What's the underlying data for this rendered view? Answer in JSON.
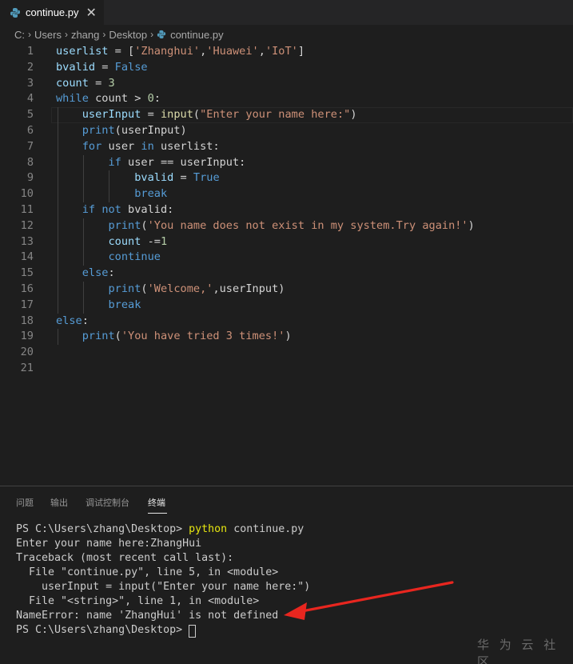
{
  "tab": {
    "label": "continue.py",
    "close_glyph": "✕"
  },
  "breadcrumb": {
    "drive": "C:",
    "items": [
      "Users",
      "zhang",
      "Desktop"
    ],
    "file": "continue.py"
  },
  "editor": {
    "line_numbers": [
      "1",
      "2",
      "3",
      "4",
      "5",
      "6",
      "7",
      "8",
      "9",
      "10",
      "11",
      "12",
      "13",
      "14",
      "15",
      "16",
      "17",
      "18",
      "19",
      "20",
      "21"
    ],
    "lines": [
      [
        [
          "userlist",
          "var"
        ],
        [
          " = [",
          "op"
        ],
        [
          "'Zhanghui'",
          "str"
        ],
        [
          ",",
          "op"
        ],
        [
          "'Huawei'",
          "str"
        ],
        [
          ",",
          "op"
        ],
        [
          "'IoT'",
          "str"
        ],
        [
          "]",
          "op"
        ]
      ],
      [
        [
          "bvalid",
          "var"
        ],
        [
          " = ",
          "op"
        ],
        [
          "False",
          "kw"
        ]
      ],
      [
        [
          "count",
          "var"
        ],
        [
          " = ",
          "op"
        ],
        [
          "3",
          "num"
        ]
      ],
      [
        [
          "while",
          "kw"
        ],
        [
          " count > ",
          "op"
        ],
        [
          "0",
          "num"
        ],
        [
          ":",
          "op"
        ]
      ],
      [
        [
          "    ",
          "op"
        ],
        [
          "userInput",
          "var"
        ],
        [
          " = ",
          "op"
        ],
        [
          "input",
          "fn"
        ],
        [
          "(",
          "op"
        ],
        [
          "\"Enter your name here:\"",
          "str"
        ],
        [
          ")",
          "op"
        ]
      ],
      [
        [
          "    ",
          "op"
        ],
        [
          "print",
          "kw"
        ],
        [
          "(userInput)",
          "op"
        ]
      ],
      [
        [
          "    ",
          "op"
        ],
        [
          "for",
          "kw"
        ],
        [
          " user ",
          "op"
        ],
        [
          "in",
          "kw"
        ],
        [
          " userlist:",
          "op"
        ]
      ],
      [
        [
          "        ",
          "op"
        ],
        [
          "if",
          "kw"
        ],
        [
          " user == userInput:",
          "op"
        ]
      ],
      [
        [
          "            ",
          "op"
        ],
        [
          "bvalid",
          "var"
        ],
        [
          " = ",
          "op"
        ],
        [
          "True",
          "kw"
        ]
      ],
      [
        [
          "            ",
          "op"
        ],
        [
          "break",
          "kw"
        ]
      ],
      [
        [
          "    ",
          "op"
        ],
        [
          "if",
          "kw"
        ],
        [
          " ",
          "op"
        ],
        [
          "not",
          "kw"
        ],
        [
          " bvalid:",
          "op"
        ]
      ],
      [
        [
          "        ",
          "op"
        ],
        [
          "print",
          "kw"
        ],
        [
          "(",
          "op"
        ],
        [
          "'You name does not exist in my system.Try again!'",
          "str"
        ],
        [
          ")",
          "op"
        ]
      ],
      [
        [
          "        ",
          "op"
        ],
        [
          "count",
          "var"
        ],
        [
          " -=",
          "op"
        ],
        [
          "1",
          "num"
        ]
      ],
      [
        [
          "        ",
          "op"
        ],
        [
          "continue",
          "kw"
        ]
      ],
      [
        [
          "    ",
          "op"
        ],
        [
          "else",
          "kw"
        ],
        [
          ":",
          "op"
        ]
      ],
      [
        [
          "        ",
          "op"
        ],
        [
          "print",
          "kw"
        ],
        [
          "(",
          "op"
        ],
        [
          "'Welcome,'",
          "str"
        ],
        [
          ",userInput)",
          "op"
        ]
      ],
      [
        [
          "        ",
          "op"
        ],
        [
          "break",
          "kw"
        ]
      ],
      [
        [
          "else",
          "kw"
        ],
        [
          ":",
          "op"
        ]
      ],
      [
        [
          "    ",
          "op"
        ],
        [
          "print",
          "kw"
        ],
        [
          "(",
          "op"
        ],
        [
          "'You have tried 3 times!'",
          "str"
        ],
        [
          ")",
          "op"
        ]
      ],
      [],
      []
    ]
  },
  "panel": {
    "tabs": [
      "问题",
      "输出",
      "调试控制台",
      "终端"
    ],
    "active_tab": "终端"
  },
  "terminal": {
    "lines": [
      [
        [
          "PS C:\\Users\\zhang\\Desktop> ",
          "plain"
        ],
        [
          "python",
          "cmd"
        ],
        [
          " continue.py",
          "plain"
        ]
      ],
      [
        [
          "Enter your name here:ZhangHui",
          "plain"
        ]
      ],
      [
        [
          "Traceback (most recent call last):",
          "plain"
        ]
      ],
      [
        [
          "  File \"continue.py\", line 5, in <module>",
          "plain"
        ]
      ],
      [
        [
          "    userInput = input(\"Enter your name here:\")",
          "plain"
        ]
      ],
      [
        [
          "  File \"<string>\", line 1, in <module>",
          "plain"
        ]
      ],
      [
        [
          "NameError: name 'ZhangHui' is not defined",
          "plain"
        ]
      ],
      [
        [
          "PS C:\\Users\\zhang\\Desktop> ",
          "plain"
        ]
      ]
    ]
  },
  "colors": {
    "background": "#1e1e1e",
    "keyword": "#569cd6",
    "string": "#ce9178",
    "number": "#b5cea8",
    "variable": "#9cdcfe",
    "annotation_arrow": "#e8261f"
  },
  "watermark": "华 为 云 社 区"
}
